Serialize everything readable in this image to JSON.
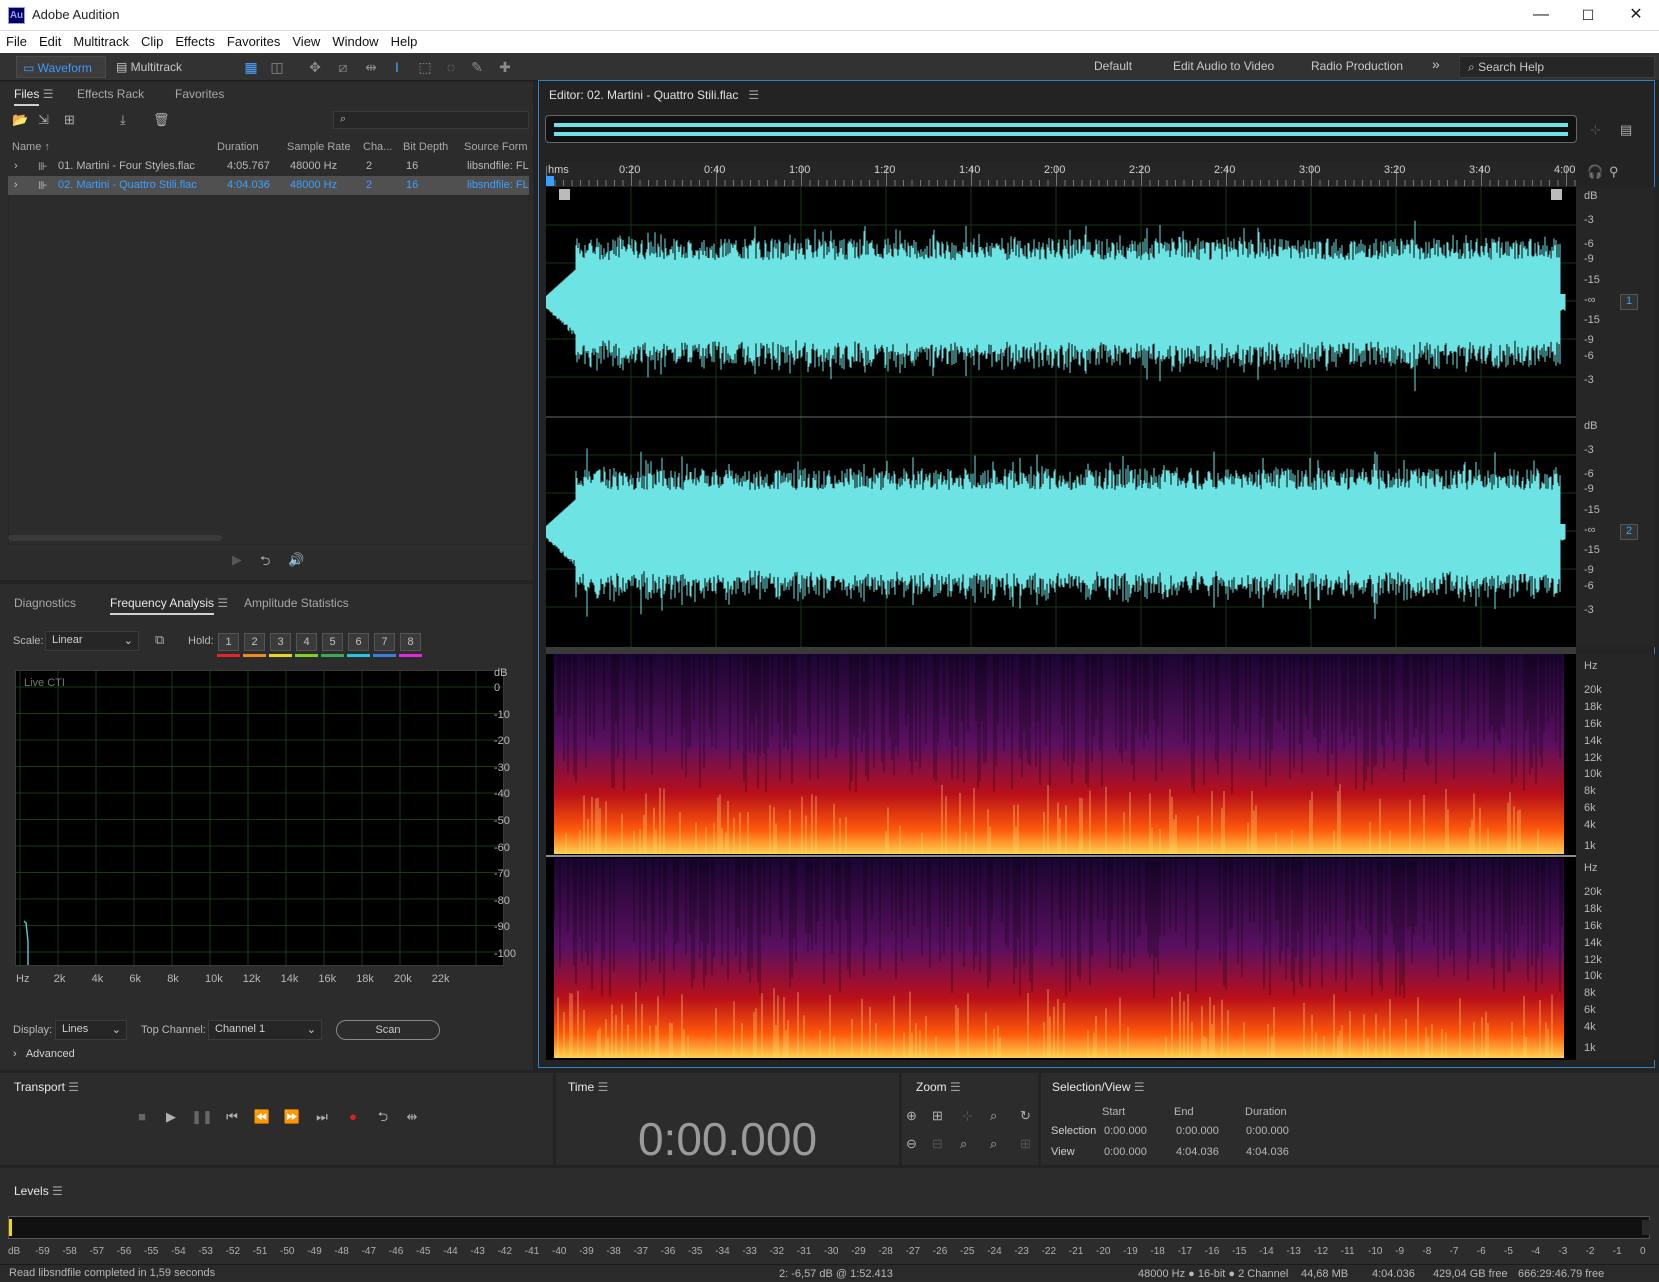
{
  "window": {
    "title": "Adobe Audition",
    "app_badge": "Au",
    "minimize": "—",
    "maximize": "☐",
    "close": "✕"
  },
  "menu": [
    "File",
    "Edit",
    "Multitrack",
    "Clip",
    "Effects",
    "Favorites",
    "View",
    "Window",
    "Help"
  ],
  "toolbar": {
    "waveform_label": "Waveform",
    "multitrack_label": "Multitrack",
    "workspaces": [
      "Default",
      "Edit Audio to Video",
      "Radio Production"
    ],
    "more": "»",
    "search_placeholder": "Search Help"
  },
  "files_panel": {
    "tabs": [
      "Files",
      "Effects Rack",
      "Favorites"
    ],
    "columns": [
      "Name",
      "Duration",
      "Sample Rate",
      "Cha...",
      "Bit Depth",
      "Source Form..."
    ],
    "rows": [
      {
        "name": "01. Martini - Four Styles.flac",
        "duration": "4:05.767",
        "rate": "48000 Hz",
        "ch": "2",
        "bits": "16",
        "source": "libsndfile: FL",
        "selected": false
      },
      {
        "name": "02. Martini - Quattro Stili.flac",
        "duration": "4:04.036",
        "rate": "48000 Hz",
        "ch": "2",
        "bits": "16",
        "source": "libsndfile: FL",
        "selected": true
      }
    ]
  },
  "analysis_panel": {
    "tabs": [
      "Diagnostics",
      "Frequency Analysis",
      "Amplitude Statistics"
    ],
    "scale_label": "Scale:",
    "scale_value": "Linear",
    "hold_label": "Hold:",
    "hold_buttons": [
      "1",
      "2",
      "3",
      "4",
      "5",
      "6",
      "7",
      "8"
    ],
    "hold_colors": [
      "#e3262a",
      "#f08c1e",
      "#e8d81e",
      "#7ed321",
      "#3aa95a",
      "#24c6e0",
      "#3b7de0",
      "#e02ae0"
    ],
    "live_cti": "Live CTI",
    "db_label": "dB",
    "db_ticks": [
      "0",
      "-10",
      "-20",
      "-30",
      "-40",
      "-50",
      "-60",
      "-70",
      "-80",
      "-90",
      "-100"
    ],
    "hz_ticks": [
      "Hz",
      "2k",
      "4k",
      "6k",
      "8k",
      "10k",
      "12k",
      "14k",
      "16k",
      "18k",
      "20k",
      "22k"
    ],
    "display_label": "Display:",
    "display_value": "Lines",
    "top_channel_label": "Top Channel:",
    "top_channel_value": "Channel 1",
    "scan_label": "Scan",
    "advanced_label": "Advanced"
  },
  "editor": {
    "title": "Editor: 02. Martini - Quattro Stili.flac",
    "ruler": [
      "hms",
      "0:20",
      "0:40",
      "1:00",
      "1:20",
      "1:40",
      "2:00",
      "2:20",
      "2:40",
      "3:00",
      "3:20",
      "3:40",
      "4:00"
    ],
    "db_scale": [
      "dB",
      "-3",
      "-6",
      "-9",
      "-15",
      "-∞",
      "-15",
      "-9",
      "-6",
      "-3"
    ],
    "channel_badges": [
      "1",
      "2"
    ],
    "hz_scale": [
      "Hz",
      "20k",
      "18k",
      "16k",
      "14k",
      "12k",
      "10k",
      "8k",
      "6k",
      "4k",
      "1k"
    ]
  },
  "transport": {
    "title": "Transport"
  },
  "time": {
    "title": "Time",
    "value": "0:00.000"
  },
  "zoom": {
    "title": "Zoom"
  },
  "selection_view": {
    "title": "Selection/View",
    "headers": [
      "Start",
      "End",
      "Duration"
    ],
    "selection_label": "Selection",
    "view_label": "View",
    "selection": [
      "0:00.000",
      "0:00.000",
      "0:00.000"
    ],
    "view": [
      "0:00.000",
      "4:04.036",
      "4:04.036"
    ]
  },
  "levels": {
    "title": "Levels",
    "ticks": [
      "dB",
      "-59",
      "-58",
      "-57",
      "-56",
      "-55",
      "-54",
      "-53",
      "-52",
      "-51",
      "-50",
      "-49",
      "-48",
      "-47",
      "-46",
      "-45",
      "-44",
      "-43",
      "-42",
      "-41",
      "-40",
      "-39",
      "-38",
      "-37",
      "-36",
      "-35",
      "-34",
      "-33",
      "-32",
      "-31",
      "-30",
      "-29",
      "-28",
      "-27",
      "-26",
      "-25",
      "-24",
      "-23",
      "-22",
      "-21",
      "-20",
      "-19",
      "-18",
      "-17",
      "-16",
      "-15",
      "-14",
      "-13",
      "-12",
      "-11",
      "-10",
      "-9",
      "-8",
      "-7",
      "-6",
      "-5",
      "-4",
      "-3",
      "-2",
      "-1",
      "0"
    ]
  },
  "status": {
    "left": "Read libsndfile completed in 1,59 seconds",
    "cursor": "2: -6,57 dB @ 1:52.413",
    "format": "48000 Hz ● 16-bit ● 2 Channel",
    "size": "44,68 MB",
    "duration": "4:04.036",
    "free": "429,04 GB free",
    "free_time": "666:29:46.79 free"
  }
}
